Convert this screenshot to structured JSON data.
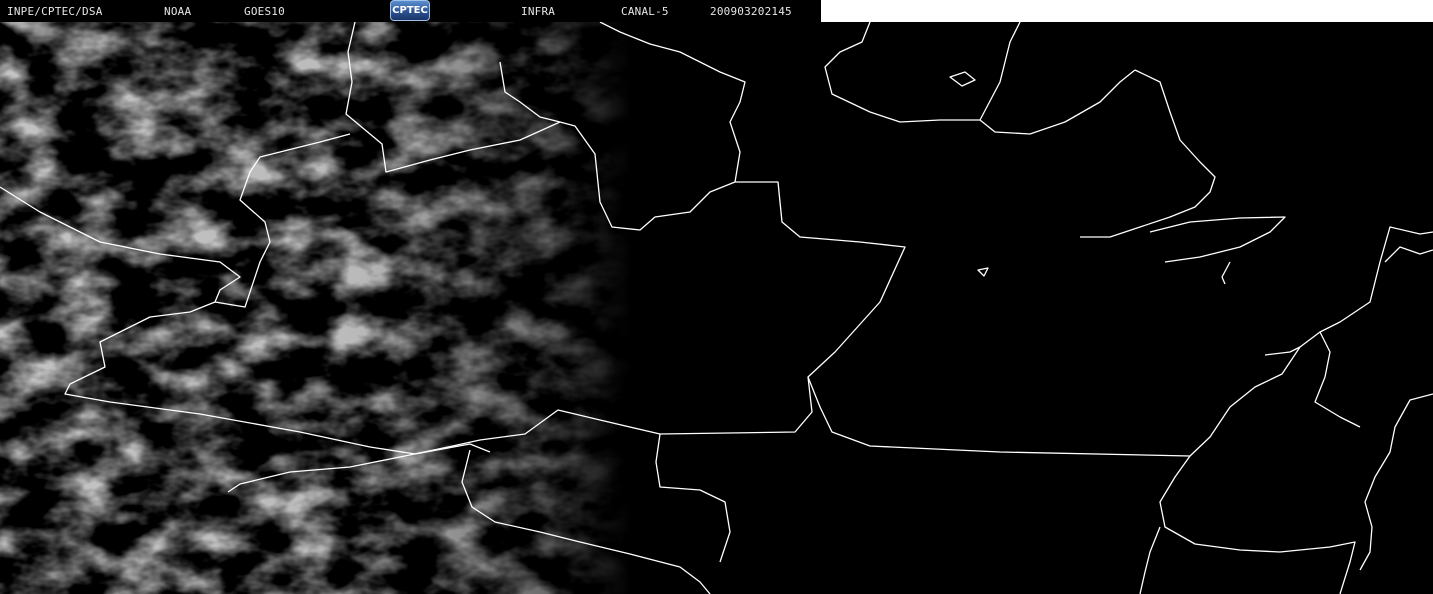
{
  "header": {
    "agency": "INPE/CPTEC/DSA",
    "organization": "NOAA",
    "satellite": "GOES10",
    "band": "INFRA",
    "channel": "CANAL-5",
    "timestamp": "200903202145"
  },
  "logo": {
    "text": "CPTEC"
  },
  "colors": {
    "background": "#000000",
    "border": "#ffffff",
    "cloud": "#7a7a7a"
  }
}
